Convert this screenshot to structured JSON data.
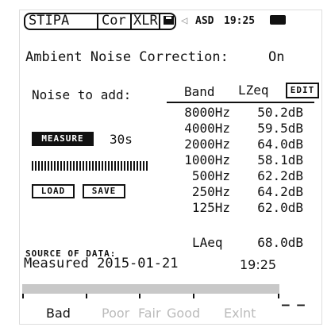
{
  "topbar": {
    "tabs": [
      "STIPA",
      "Cor",
      "XLR"
    ],
    "speaker_glyph": "◁",
    "device_label": "ASD",
    "time": "19:25"
  },
  "title": {
    "label": "Ambient Noise Correction:",
    "value": "On"
  },
  "left": {
    "noise_label": "Noise to add:",
    "measure_label": "MEASURE",
    "duration": "30s",
    "load_label": "LOAD",
    "save_label": "SAVE",
    "source_label": "SOURCE OF DATA:",
    "measured_text": "Measured 2015-01-21",
    "measured_time": "19:25"
  },
  "table": {
    "band_header": "Band",
    "leq_header": "LZeq",
    "edit_label": "EDIT",
    "rows": [
      {
        "band": "8000Hz",
        "level": "50.2dB"
      },
      {
        "band": "4000Hz",
        "level": "59.5dB"
      },
      {
        "band": "2000Hz",
        "level": "64.0dB"
      },
      {
        "band": "1000Hz",
        "level": "58.1dB"
      },
      {
        "band": "500Hz",
        "level": "62.2dB"
      },
      {
        "band": "250Hz",
        "level": "64.2dB"
      },
      {
        "band": "125Hz",
        "level": "62.0dB"
      }
    ],
    "laeq_label": "LAeq",
    "laeq_value": "68.0dB"
  },
  "quality": {
    "labels": [
      "Bad",
      "Poor",
      "Fair",
      "Good",
      "Exlnt"
    ],
    "active": "Bad",
    "dashes": "– –",
    "colors": {
      "active": "#111111",
      "inactive": "#bbbbbb"
    }
  }
}
